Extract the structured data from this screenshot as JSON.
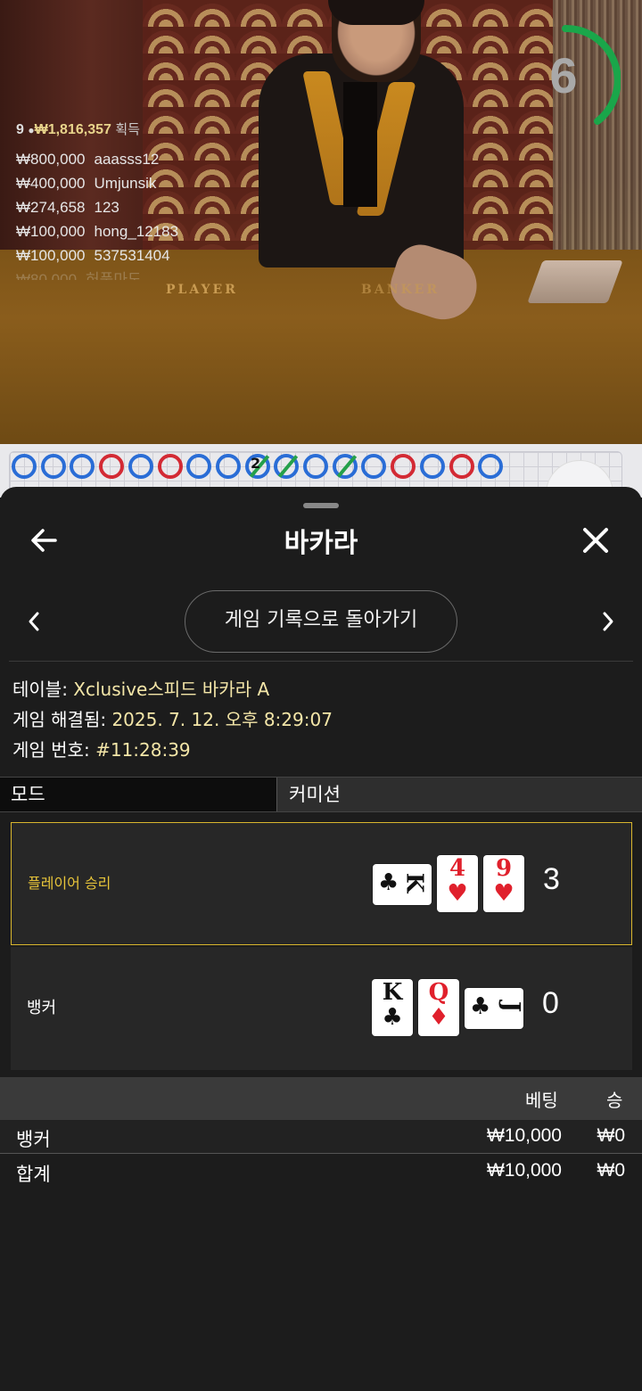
{
  "video": {
    "timer": "6",
    "table_labels": [
      "PLAYER",
      "BANKER"
    ],
    "winners": {
      "count": "9",
      "total": "₩1,816,357",
      "suffix": "획득",
      "rows": [
        {
          "amount": "₩800,000",
          "name": "aaasss12"
        },
        {
          "amount": "₩400,000",
          "name": "Umjunsik"
        },
        {
          "amount": "₩274,658",
          "name": "123"
        },
        {
          "amount": "₩100,000",
          "name": "hong_12183"
        },
        {
          "amount": "₩100,000",
          "name": "537531404"
        },
        {
          "amount": "₩80,000",
          "name": "허풍마도"
        }
      ]
    }
  },
  "roadmap": {
    "tie_count": "2",
    "beads": [
      "P",
      "P",
      "P",
      "B",
      "P",
      "B",
      "P",
      "P",
      "T",
      "T",
      "P",
      "T",
      "P",
      "B",
      "P",
      "B",
      "P"
    ]
  },
  "sheet": {
    "title": "바카라",
    "history_button": "게임 기록으로 돌아가기",
    "info": [
      {
        "label": "테이블: ",
        "value": "Xclusive스피드 바카라 A"
      },
      {
        "label": "게임 해결됨: ",
        "value": "2025. 7. 12. 오후 8:29:07"
      },
      {
        "label": "게임 번호: ",
        "value": "#11:28:39"
      }
    ],
    "tabs": {
      "mode": "모드",
      "commission": "커미션"
    },
    "player": {
      "label": "플레이어 승리",
      "score": "3",
      "cards": [
        {
          "rank": "K",
          "suit": "♣",
          "color": "#111111",
          "rotated": true
        },
        {
          "rank": "4",
          "suit": "♥",
          "color": "#e0202c",
          "rotated": false
        },
        {
          "rank": "9",
          "suit": "♥",
          "color": "#e0202c",
          "rotated": false
        }
      ]
    },
    "banker": {
      "label": "뱅커",
      "score": "0",
      "cards": [
        {
          "rank": "K",
          "suit": "♣",
          "color": "#111111",
          "rotated": false
        },
        {
          "rank": "Q",
          "suit": "♦",
          "color": "#e0202c",
          "rotated": false
        },
        {
          "rank": "J",
          "suit": "♣",
          "color": "#111111",
          "rotated": true
        }
      ]
    },
    "bets": {
      "headers": {
        "bet": "베팅",
        "win": "승"
      },
      "rows": [
        {
          "name": "뱅커",
          "bet": "₩10,000",
          "win": "₩0"
        }
      ],
      "total": {
        "name": "합계",
        "bet": "₩10,000",
        "win": "₩0"
      }
    }
  }
}
